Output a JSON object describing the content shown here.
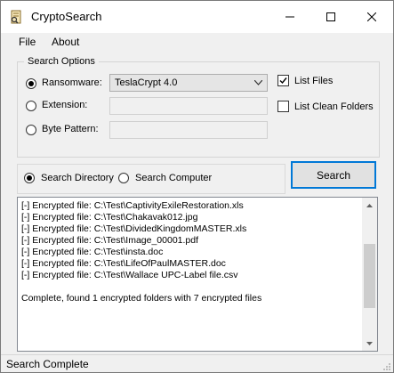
{
  "window": {
    "title": "CryptoSearch"
  },
  "menu": {
    "file": "File",
    "about": "About"
  },
  "search_options": {
    "title": "Search Options",
    "ransomware_label": "Ransomware:",
    "ransomware_value": "TeslaCrypt 4.0",
    "extension_label": "Extension:",
    "extension_value": "",
    "byte_pattern_label": "Byte Pattern:",
    "byte_pattern_value": "",
    "selected_mode": "ransomware",
    "list_files_label": "List Files",
    "list_files_checked": true,
    "list_clean_folders_label": "List Clean Folders",
    "list_clean_folders_checked": false
  },
  "scope": {
    "search_directory_label": "Search Directory",
    "search_computer_label": "Search Computer",
    "selected": "directory"
  },
  "search_button": "Search",
  "log": {
    "lines": [
      "[-] Encrypted file: C:\\Test\\CaptivityExileRestoration.xls",
      "[-] Encrypted file: C:\\Test\\Chakavak012.jpg",
      "[-] Encrypted file: C:\\Test\\DividedKingdomMASTER.xls",
      "[-] Encrypted file: C:\\Test\\Image_00001.pdf",
      "[-] Encrypted file: C:\\Test\\insta.doc",
      "[-] Encrypted file: C:\\Test\\LifeOfPaulMASTER.doc",
      "[-] Encrypted file: C:\\Test\\Wallace UPC-Label file.csv"
    ],
    "summary": "Complete, found 1 encrypted folders with 7 encrypted files"
  },
  "status": "Search Complete"
}
